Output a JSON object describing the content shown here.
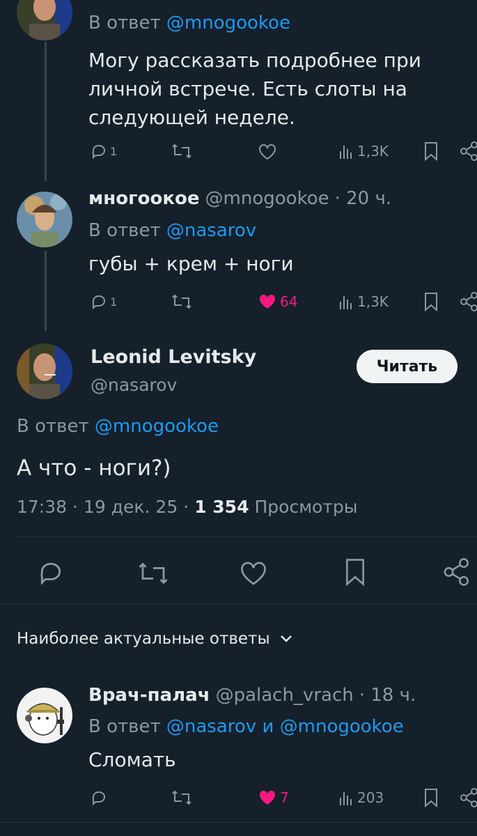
{
  "tweet1": {
    "reply_prefix": "В ответ",
    "reply_to": "@mnogookoe",
    "text_line1": "Могу рассказать подробнее при",
    "text_line2": "личной встрече. Есть слоты на",
    "text_line3": "следующей неделе.",
    "replies": "1",
    "views": "1,3K"
  },
  "tweet2": {
    "name": "многоокое",
    "handle": "@mnogookoe",
    "time": "· 20 ч.",
    "reply_prefix": "В ответ",
    "reply_to": "@nasarov",
    "text": "губы + крем + ноги",
    "replies": "1",
    "likes": "64",
    "views": "1,3K"
  },
  "main_tweet": {
    "name": "Leonid Levitsky",
    "handle": "@nasarov",
    "follow_label": "Читать",
    "reply_prefix": "В ответ",
    "reply_to": "@mnogookoe",
    "text": "А что - ноги?)",
    "time": "17:38",
    "date": "19 дек. 25",
    "views_count": "1 354",
    "views_label": "Просмотры"
  },
  "sort": {
    "label": "Наиболее актуальные ответы"
  },
  "reply": {
    "name": "Врач-палач",
    "handle": "@palach_vrach",
    "time": "· 18 ч.",
    "reply_prefix": "В ответ",
    "reply_to1": "@nasarov",
    "conj": "и",
    "reply_to2": "@mnogookoe",
    "text": "Сломать",
    "likes": "7",
    "views": "203"
  },
  "colors": {
    "background": "#15202b",
    "accent": "#1d9bf0",
    "like": "#f91880",
    "muted": "#8b98a5"
  }
}
